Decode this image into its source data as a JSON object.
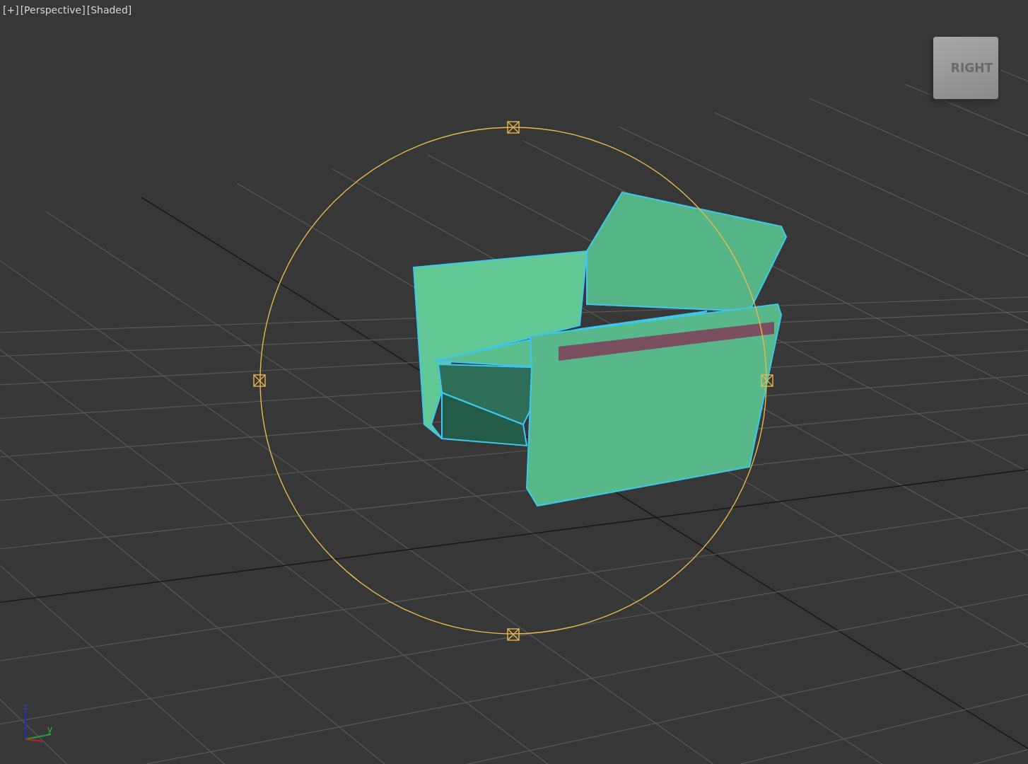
{
  "viewport": {
    "labels": [
      {
        "text": "[+]"
      },
      {
        "text": "[Perspective]"
      },
      {
        "text": "[Shaded]"
      }
    ],
    "view_cube": {
      "face_label": "RIGHT"
    },
    "axis_labels": [
      {
        "text": "z"
      },
      {
        "text": "y"
      }
    ]
  }
}
